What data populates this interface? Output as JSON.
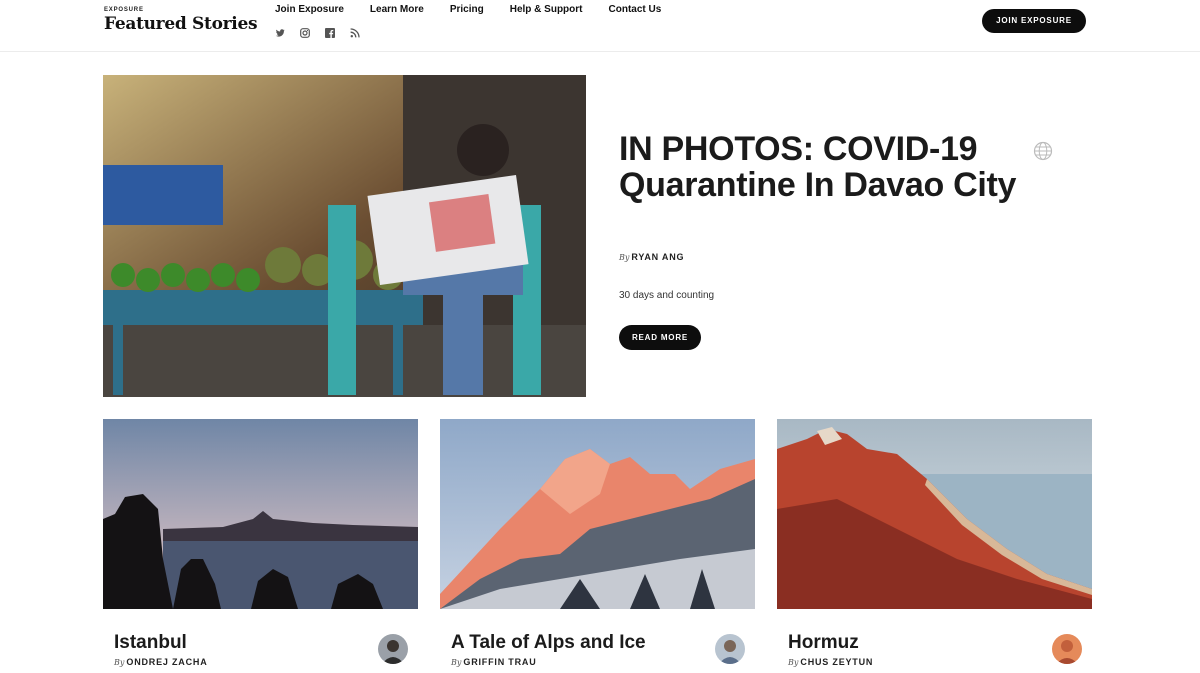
{
  "brand": {
    "small": "EXPOSURE",
    "title": "Featured Stories"
  },
  "nav": [
    {
      "label": "Join Exposure"
    },
    {
      "label": "Learn More"
    },
    {
      "label": "Pricing"
    },
    {
      "label": "Help & Support"
    },
    {
      "label": "Contact Us"
    }
  ],
  "social_icons": [
    "twitter-icon",
    "instagram-icon",
    "facebook-icon",
    "rss-icon"
  ],
  "header": {
    "join_label": "JOIN EXPOSURE"
  },
  "hero": {
    "title": "IN PHOTOS:  COVID-19 Quarantine In Davao City",
    "by_prefix": "By",
    "author": "RYAN ANG",
    "description": "30 days and counting",
    "read_more": "READ MORE",
    "globe_icon": "globe-icon"
  },
  "cards": [
    {
      "title": "Istanbul",
      "by_prefix": "By",
      "author": "ONDREJ ZACHA"
    },
    {
      "title": "A Tale of Alps and Ice",
      "by_prefix": "By",
      "author": "GRIFFIN TRAU"
    },
    {
      "title": "Hormuz",
      "by_prefix": "By",
      "author": "CHUS ZEYTUN"
    }
  ],
  "colors": {
    "button_bg": "#0d0d0d",
    "button_text": "#ffffff",
    "text": "#1b1b1b"
  }
}
